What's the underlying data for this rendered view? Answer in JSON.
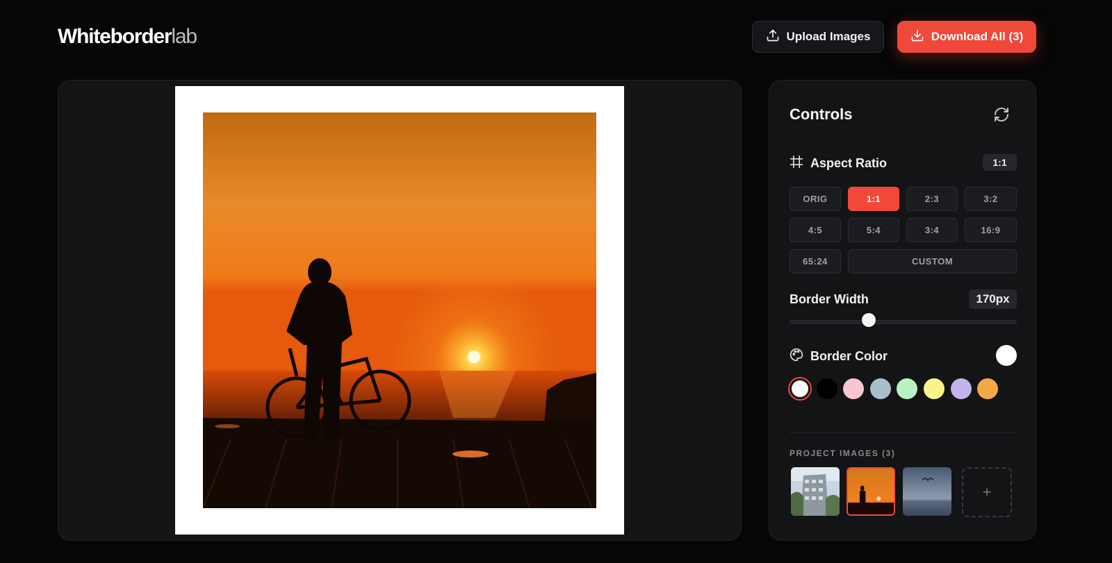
{
  "app": {
    "logo_bold": "Whiteborder",
    "logo_light": "lab"
  },
  "header": {
    "upload_label": "Upload Images",
    "download_label": "Download All (3)"
  },
  "controls": {
    "title": "Controls",
    "aspect_ratio": {
      "label": "Aspect Ratio",
      "current": "1:1",
      "options": [
        "ORIG",
        "1:1",
        "2:3",
        "3:2",
        "4:5",
        "5:4",
        "3:4",
        "16:9",
        "65:24",
        "CUSTOM"
      ],
      "selected": "1:1"
    },
    "border_width": {
      "label": "Border Width",
      "value": "170px",
      "slider_fraction": 0.35
    },
    "border_color": {
      "label": "Border Color",
      "current": "#ffffff",
      "swatches": [
        "#ffffff",
        "#000000",
        "#f9c5d1",
        "#a9bfcc",
        "#b8f2c4",
        "#fbf28a",
        "#c4b2ea",
        "#f6a74a"
      ],
      "selected_index": 0
    },
    "project_images": {
      "label": "PROJECT IMAGES (3)",
      "items": [
        "building",
        "sunset-cyclist",
        "seagull-sky"
      ],
      "active_index": 1,
      "add_symbol": "+"
    }
  },
  "colors": {
    "accent": "#f0493a",
    "background": "#060606",
    "panel": "#131416"
  }
}
